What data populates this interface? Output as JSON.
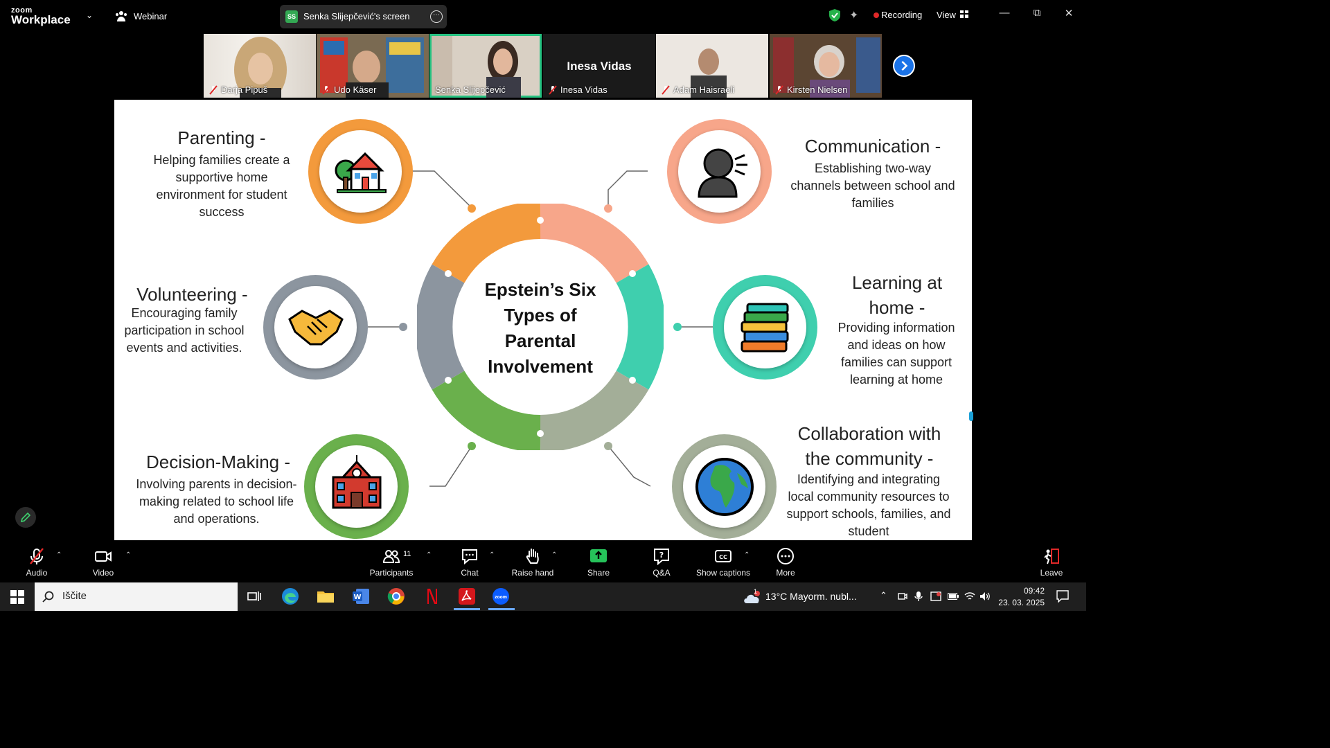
{
  "app": {
    "brand_small": "zoom",
    "brand_big": "Workplace",
    "mode": "Webinar",
    "screen_share_initials": "SS",
    "screen_share_label": "Senka Slijepčević's screen",
    "recording_label": "Recording",
    "view_label": "View"
  },
  "participants": [
    {
      "name": "Darja Pipuš",
      "muted": true
    },
    {
      "name": "Udo Käser",
      "muted": true
    },
    {
      "name": "Senka Slijepčević",
      "muted": false,
      "active": true
    },
    {
      "name": "Inesa Vidas",
      "muted": true,
      "video_off": true
    },
    {
      "name": "Adam Haisraeli",
      "muted": true
    },
    {
      "name": "Kirsten Nielsen",
      "muted": true
    }
  ],
  "slide": {
    "center_title": "Epstein’s Six Types of Parental Involvement",
    "items": [
      {
        "title": "Parenting -",
        "body": "Helping families create a supportive home environment for student success",
        "icon": "house-icon"
      },
      {
        "title": "Communication -",
        "body": "Establishing two-way channels between school and families",
        "icon": "speaking-head-icon"
      },
      {
        "title": "Volunteering -",
        "body": "Encouraging family participation in school events and activities.",
        "icon": "handshake-icon"
      },
      {
        "title": "Learning at home -",
        "body": "Providing information and ideas on how families can support learning at home",
        "icon": "books-icon"
      },
      {
        "title": "Decision-Making -",
        "body": "Involving parents in decision-making related to school life and operations.",
        "icon": "school-icon"
      },
      {
        "title": "Collaboration with the community -",
        "body": "Identifying and integrating local community resources to support schools, families, and student",
        "icon": "globe-icon"
      }
    ],
    "colors": {
      "orange": "#f39a3c",
      "salmon": "#f7a68a",
      "gray": "#8c959f",
      "teal": "#3fcfae",
      "green": "#6ab04c",
      "sage": "#a3ae98"
    }
  },
  "toolbar": {
    "audio": "Audio",
    "video": "Video",
    "participants": "Participants",
    "participants_count": "11",
    "chat": "Chat",
    "raise_hand": "Raise hand",
    "share": "Share",
    "qa": "Q&A",
    "captions": "Show captions",
    "more": "More",
    "leave": "Leave"
  },
  "taskbar": {
    "search": "Iščite",
    "weather": "13°C  Mayorm. nubl...",
    "time": "09:42",
    "date": "23. 03. 2025",
    "weather_badge": "1"
  }
}
